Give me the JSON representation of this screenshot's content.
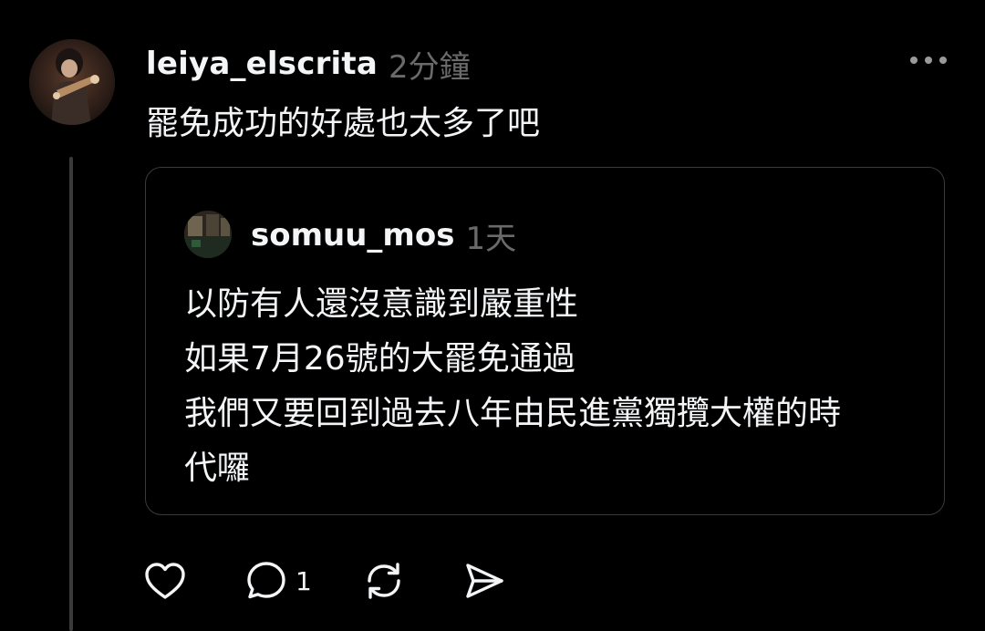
{
  "post": {
    "username": "leiya_elscrita",
    "timestamp": "2分鐘",
    "text": "罷免成功的好處也太多了吧"
  },
  "quoted_post": {
    "username": "somuu_mos",
    "timestamp": "1天",
    "lines": [
      "以防有人還沒意識到嚴重性",
      "如果7月26號的大罷免通過",
      "我們又要回到過去八年由民進黨獨攬大權的時",
      "代囉"
    ]
  },
  "actions": {
    "reply_count": "1"
  },
  "icons": {
    "more": "more-dots-icon",
    "like": "heart-icon",
    "reply": "comment-bubble-icon",
    "repost": "repost-icon",
    "share": "send-icon"
  },
  "colors": {
    "background": "#000000",
    "text": "#f3f5f7",
    "muted": "#6a6a6a",
    "border": "#3a3a3a"
  }
}
